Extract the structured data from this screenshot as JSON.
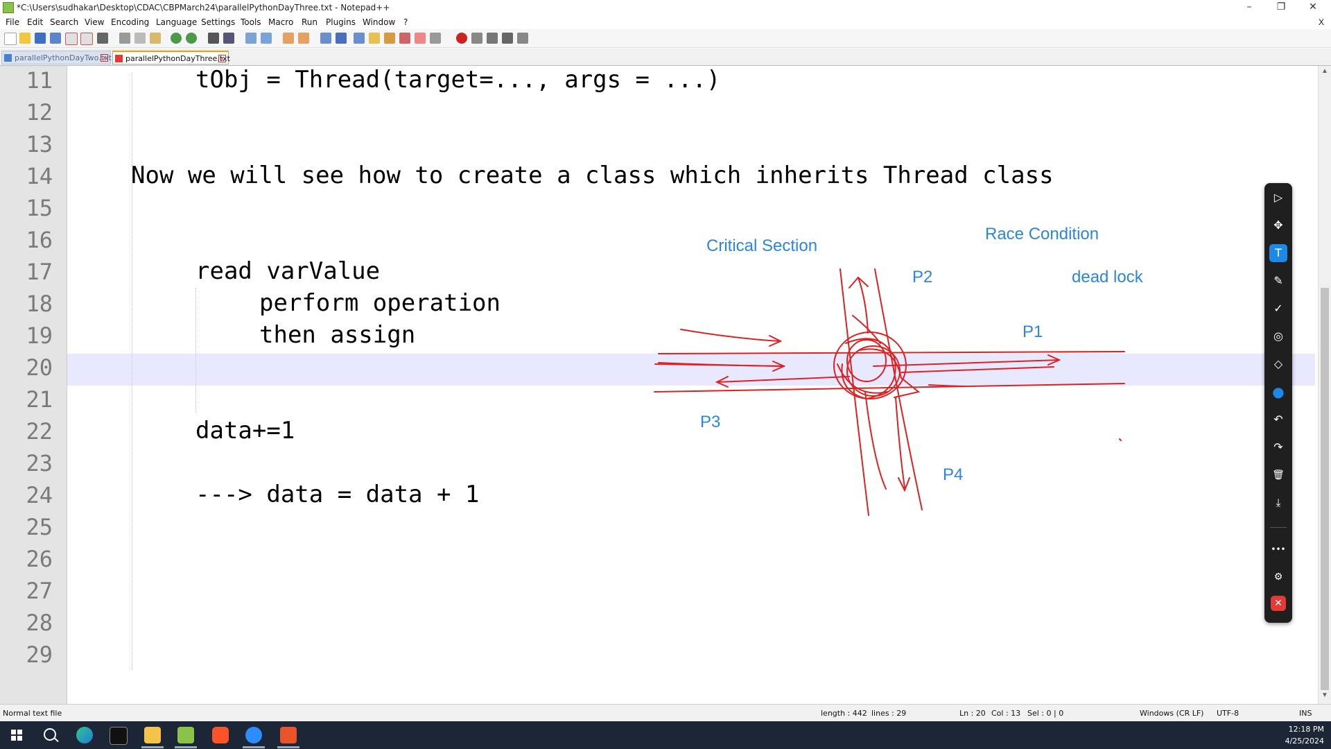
{
  "window": {
    "title": "*C:\\Users\\sudhakar\\Desktop\\CDAC\\CBPMarch24\\parallelPythonDayThree.txt - Notepad++",
    "minimize_glyph": "–",
    "restore_glyph": "❐",
    "close_glyph": "✕"
  },
  "menu": {
    "items": [
      "File",
      "Edit",
      "Search",
      "View",
      "Encoding",
      "Language",
      "Settings",
      "Tools",
      "Macro",
      "Run",
      "Plugins",
      "Window",
      "?"
    ],
    "close_label": "X"
  },
  "tabs": [
    {
      "label": "parallelPythonDayTwo.txt",
      "active": false
    },
    {
      "label": "parallelPythonDayThree.txt",
      "active": true
    }
  ],
  "editor": {
    "line_numbers": [
      "11",
      "12",
      "13",
      "14",
      "15",
      "16",
      "17",
      "18",
      "19",
      "20",
      "21",
      "22",
      "23",
      "24",
      "25",
      "26",
      "27",
      "28",
      "29"
    ],
    "lines": {
      "l11": "tObj = Thread(target=..., args = ...)",
      "l14": "Now we will see how to create a class which inherits Thread class",
      "l17": "read varValue",
      "l18": "perform operation",
      "l19": "then assign",
      "l22": "data+=1",
      "l24": "---> data = data + 1"
    },
    "current_line": "20",
    "highlight_color": "#e8e8ff"
  },
  "annotations": {
    "critical_section": "Critical Section",
    "race_condition": "Race Condition",
    "dead_lock": "dead lock",
    "p1": "P1",
    "p2": "P2",
    "p3": "P3",
    "p4": "P4",
    "ink_color": "#e02020",
    "text_color": "#2b86e0"
  },
  "pen_toolbar": {
    "tools": [
      {
        "icon": "select-arrow-icon",
        "glyph": "▷"
      },
      {
        "icon": "move-icon",
        "glyph": "✥"
      },
      {
        "icon": "text-icon",
        "glyph": "T",
        "active": true
      },
      {
        "icon": "pen-icon",
        "glyph": "✎"
      },
      {
        "icon": "check-icon",
        "glyph": "✓"
      },
      {
        "icon": "highlighter-icon",
        "glyph": "◎"
      },
      {
        "icon": "eraser-icon",
        "glyph": "◇"
      },
      {
        "icon": "color-dot-icon",
        "glyph": "●"
      },
      {
        "icon": "undo-icon",
        "glyph": "↶"
      },
      {
        "icon": "redo-icon",
        "glyph": "↷"
      },
      {
        "icon": "trash-icon",
        "glyph": "🗑"
      },
      {
        "icon": "download-icon",
        "glyph": "⤓"
      },
      {
        "icon": "more-icon",
        "glyph": "•••"
      },
      {
        "icon": "user-settings-icon",
        "glyph": "⚙"
      },
      {
        "icon": "close-icon",
        "glyph": "✕"
      }
    ]
  },
  "status": {
    "file_type": "Normal text file",
    "length": "length : 442",
    "lines": "lines : 29",
    "ln": "Ln : 20",
    "col": "Col : 13",
    "sel": "Sel : 0 | 0",
    "eol": "Windows (CR LF)",
    "encoding": "UTF-8",
    "mode": "INS"
  },
  "taskbar": {
    "time": "12:18 PM",
    "date": "4/25/2024",
    "apps": [
      {
        "icon": "windows-start-icon"
      },
      {
        "icon": "search-icon"
      },
      {
        "icon": "edge-browser-icon"
      },
      {
        "icon": "terminal-icon"
      },
      {
        "icon": "file-explorer-icon"
      },
      {
        "icon": "notepadpp-icon"
      },
      {
        "icon": "brave-browser-icon"
      },
      {
        "icon": "zoom-icon"
      },
      {
        "icon": "screenshot-tool-icon"
      }
    ]
  }
}
